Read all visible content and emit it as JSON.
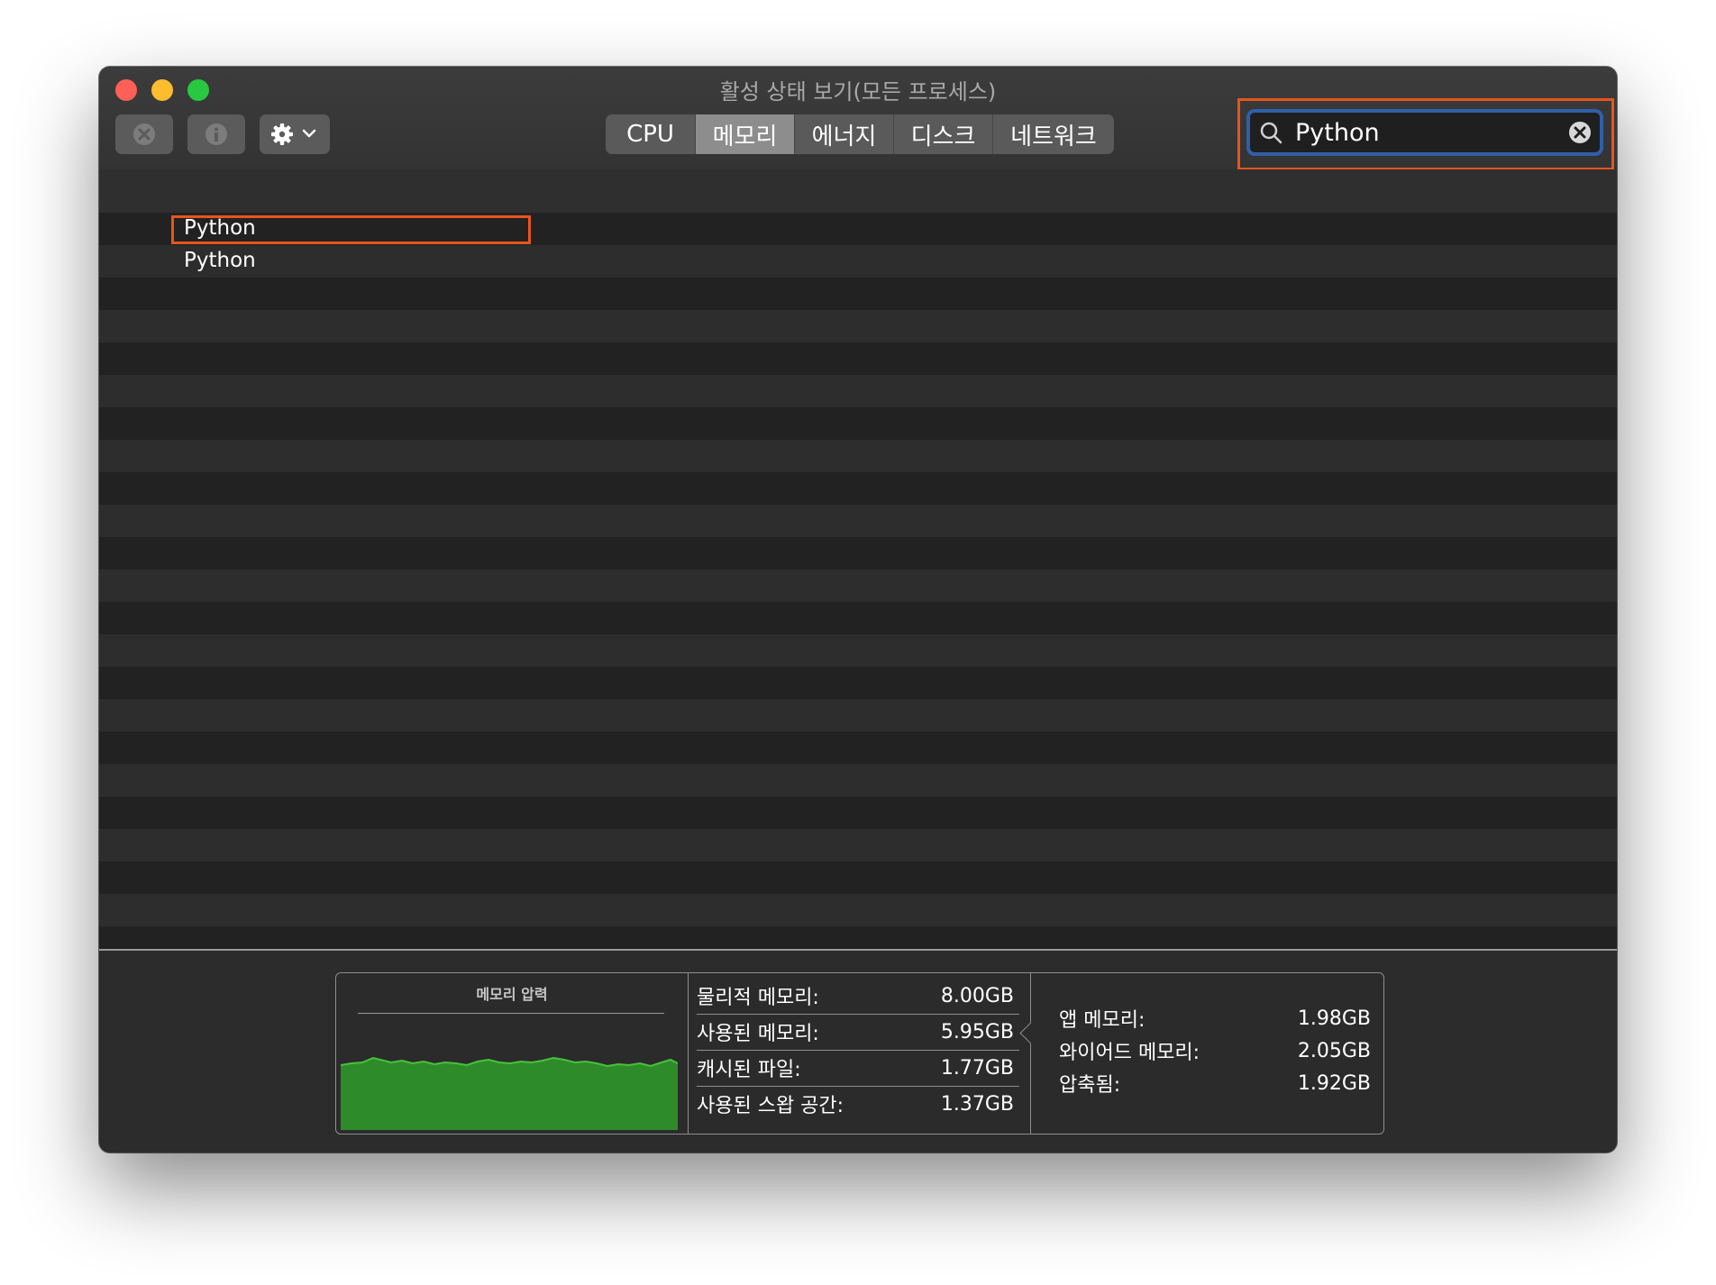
{
  "window": {
    "title": "활성 상태 보기(모든 프로세스)"
  },
  "tabs": [
    {
      "label": "CPU",
      "active": false
    },
    {
      "label": "메모리",
      "active": true
    },
    {
      "label": "에너지",
      "active": false
    },
    {
      "label": "디스크",
      "active": false
    },
    {
      "label": "네트워크",
      "active": false
    }
  ],
  "search": {
    "value": "Python"
  },
  "processes": [
    {
      "name": "Python"
    },
    {
      "name": "Python"
    }
  ],
  "memory": {
    "pressure_title": "메모리 압력",
    "stats_left": [
      {
        "label": "물리적 메모리:",
        "value": "8.00GB"
      },
      {
        "label": "사용된 메모리:",
        "value": "5.95GB"
      },
      {
        "label": "캐시된 파일:",
        "value": "1.77GB"
      },
      {
        "label": "사용된 스왑 공간:",
        "value": "1.37GB"
      }
    ],
    "stats_right": [
      {
        "label": "앱 메모리:",
        "value": "1.98GB"
      },
      {
        "label": "와이어드 메모리:",
        "value": "2.05GB"
      },
      {
        "label": "압축됨:",
        "value": "1.92GB"
      }
    ]
  },
  "colors": {
    "highlight": "#e8551a",
    "pressure_green": "#2e8b2a",
    "search_ring": "#2f5fa8"
  }
}
